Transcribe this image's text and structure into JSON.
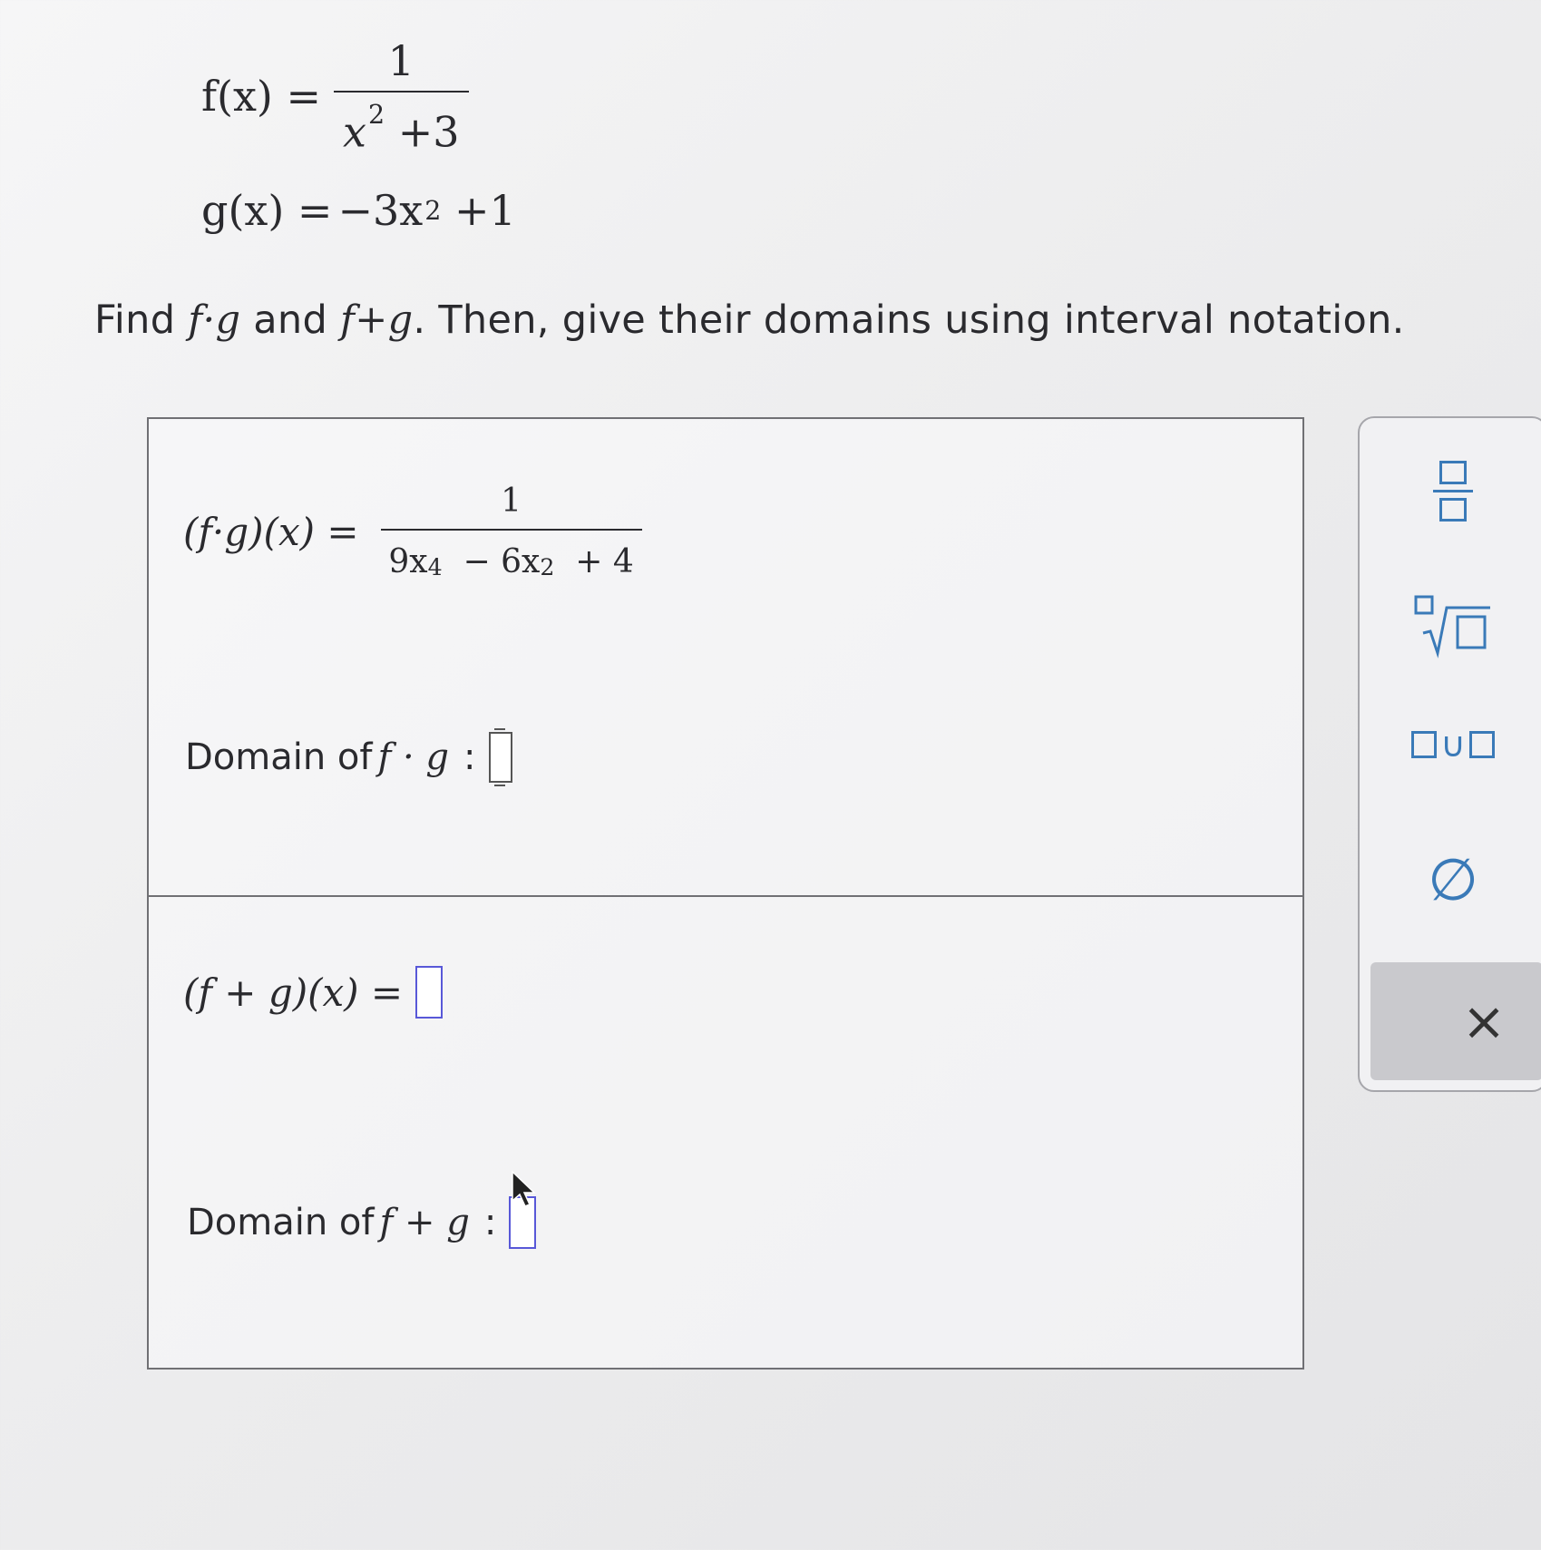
{
  "given": {
    "f_lhs": "f(x) =",
    "f_num": "1",
    "f_den_base": "x",
    "f_den_exp": "2",
    "f_den_rest": " +3",
    "g_lhs": "g(x) =",
    "g_rhs_a": "−3x",
    "g_rhs_exp": "2",
    "g_rhs_b": " +1"
  },
  "prompt": {
    "t1": "Find ",
    "m1": "f·g",
    "t2": " and ",
    "m2": "f+g",
    "t3": ". Then, give their domains using interval notation."
  },
  "section_fg": {
    "lhs": "(f·g)(x) =",
    "num": "1",
    "den_a": "9x",
    "den_a_exp": "4",
    "den_b": "  − 6x",
    "den_b_exp": "2",
    "den_c": "  + 4",
    "domain_label": "Domain of",
    "domain_math": "f · g",
    "domain_colon": ":",
    "domain_value": ""
  },
  "section_fpg": {
    "lhs": "(f + g)(x) =",
    "answer_value": "",
    "domain_label": "Domain of",
    "domain_math": "f + g",
    "domain_colon": ":",
    "domain_value": ""
  },
  "toolbar": {
    "union_symbol": "∪",
    "empty_set_symbol": "∅",
    "clear_symbol": "×",
    "accent_color": "#3a7ab8"
  },
  "colors": {
    "answer_box_border": "#5858d8",
    "panel_border": "#707074"
  }
}
